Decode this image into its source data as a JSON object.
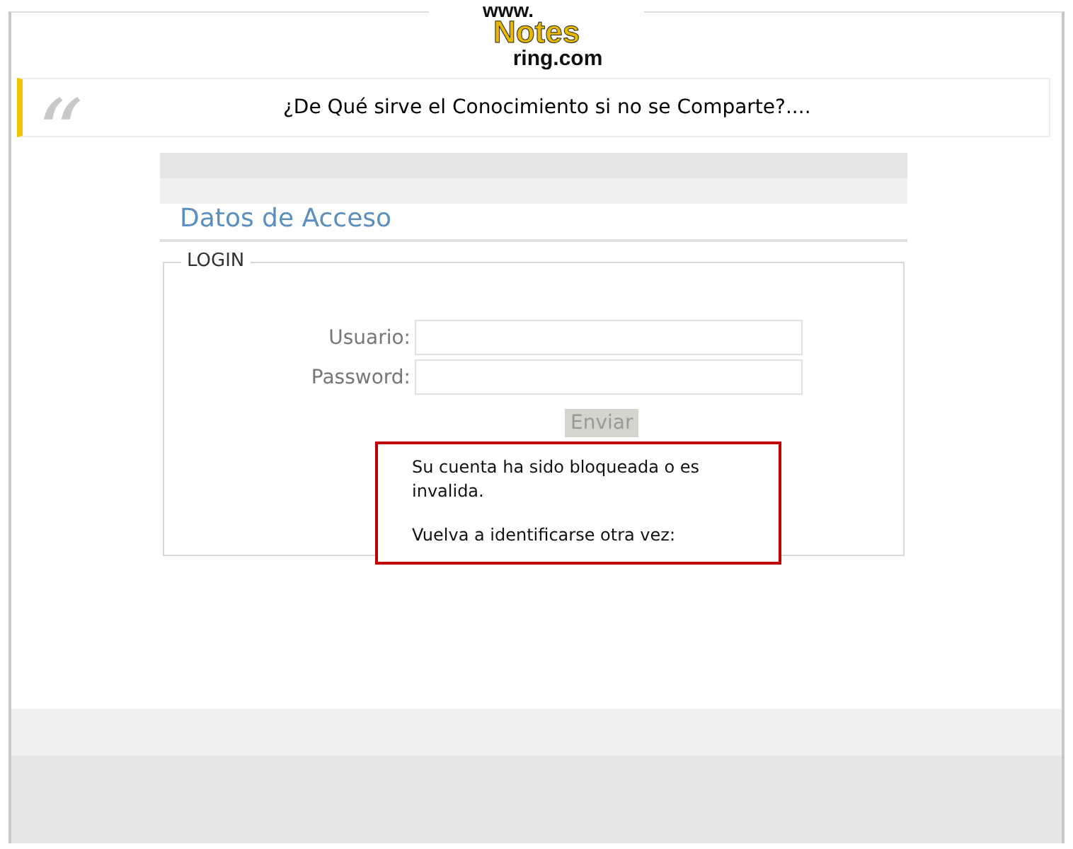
{
  "logo": {
    "prefix": "www.",
    "name": "Notes",
    "suffix": "ring.com"
  },
  "quote": {
    "mark": "“",
    "text": "¿De Qué sirve el Conocimiento si no se Comparte?...."
  },
  "panel": {
    "title": "Datos de Acceso",
    "legend": "LOGIN",
    "fields": [
      {
        "label": "Usuario:"
      },
      {
        "label": "Password:"
      }
    ],
    "submit": {
      "label": "Enviar",
      "disabled": true
    },
    "error": {
      "lines": [
        "Su cuenta ha sido bloqueada o es invalida.",
        "Vuelva a identificarse otra vez:"
      ]
    }
  }
}
